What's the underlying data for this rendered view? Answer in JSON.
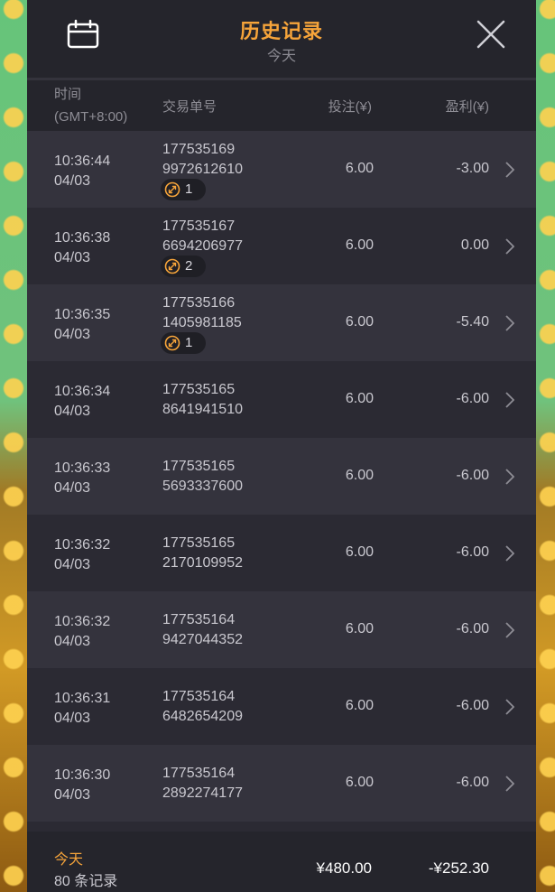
{
  "header": {
    "title": "历史记录",
    "subtitle": "今天",
    "calendar_icon": "calendar-icon",
    "close_icon": "close-icon"
  },
  "columns": {
    "time_line1": "时间",
    "time_line2": "(GMT+8:00)",
    "id": "交易单号",
    "bet": "投注(¥)",
    "profit": "盈利(¥)"
  },
  "rows": [
    {
      "time": "10:36:44",
      "date": "04/03",
      "id1": "177535169",
      "id2": "9972612610",
      "bet": "6.00",
      "profit": "-3.00",
      "badge": "1"
    },
    {
      "time": "10:36:38",
      "date": "04/03",
      "id1": "177535167",
      "id2": "6694206977",
      "bet": "6.00",
      "profit": "0.00",
      "badge": "2"
    },
    {
      "time": "10:36:35",
      "date": "04/03",
      "id1": "177535166",
      "id2": "1405981185",
      "bet": "6.00",
      "profit": "-5.40",
      "badge": "1"
    },
    {
      "time": "10:36:34",
      "date": "04/03",
      "id1": "177535165",
      "id2": "8641941510",
      "bet": "6.00",
      "profit": "-6.00"
    },
    {
      "time": "10:36:33",
      "date": "04/03",
      "id1": "177535165",
      "id2": "5693337600",
      "bet": "6.00",
      "profit": "-6.00"
    },
    {
      "time": "10:36:32",
      "date": "04/03",
      "id1": "177535165",
      "id2": "2170109952",
      "bet": "6.00",
      "profit": "-6.00"
    },
    {
      "time": "10:36:32",
      "date": "04/03",
      "id1": "177535164",
      "id2": "9427044352",
      "bet": "6.00",
      "profit": "-6.00"
    },
    {
      "time": "10:36:31",
      "date": "04/03",
      "id1": "177535164",
      "id2": "6482654209",
      "bet": "6.00",
      "profit": "-6.00"
    },
    {
      "time": "10:36:30",
      "date": "04/03",
      "id1": "177535164",
      "id2": "2892274177",
      "bet": "6.00",
      "profit": "-6.00"
    }
  ],
  "footer": {
    "period": "今天",
    "count": "80 条记录",
    "total_bet": "¥480.00",
    "total_profit": "-¥252.30"
  },
  "colors": {
    "accent": "#f6a43a",
    "panel": "#2b2a33",
    "header": "#25252c"
  }
}
